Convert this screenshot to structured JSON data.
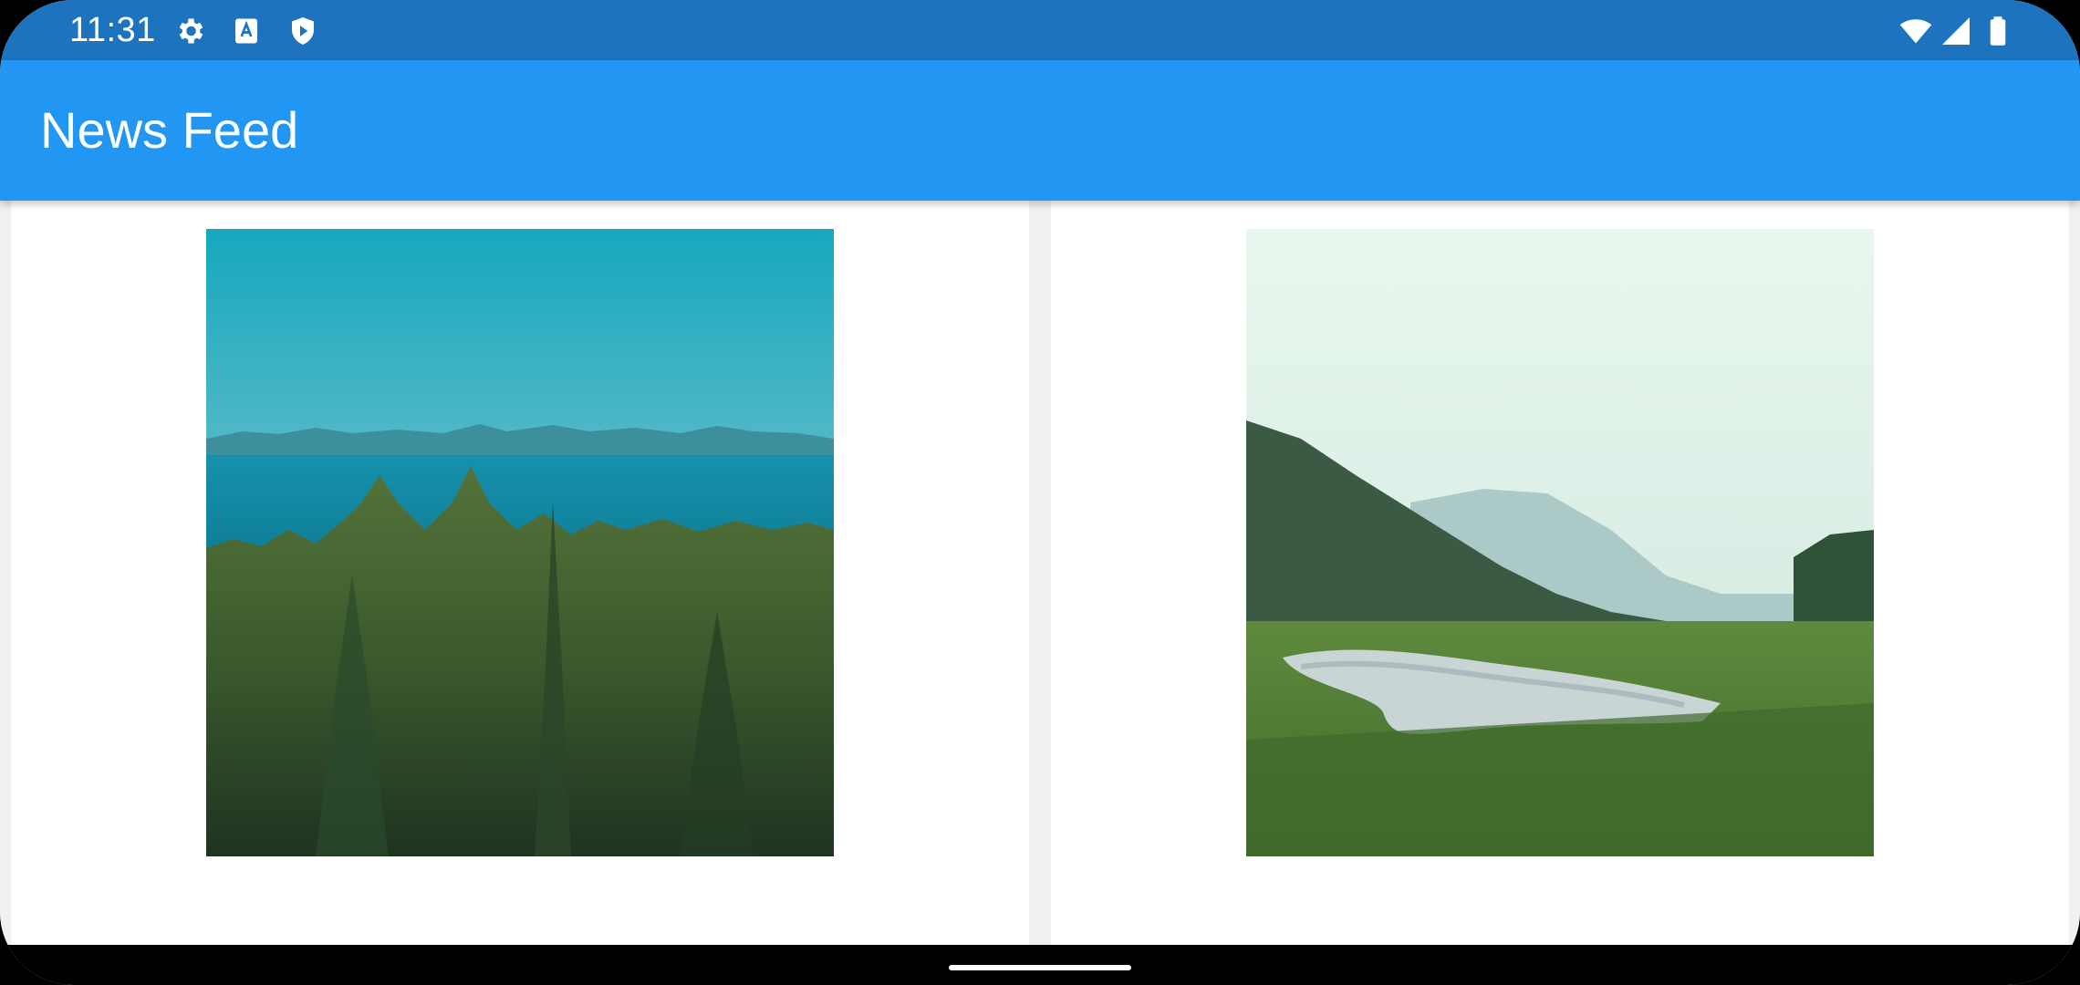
{
  "status_bar": {
    "time": "11:31",
    "left_icons": [
      "gear-icon",
      "text-a-icon",
      "play-shield-icon"
    ],
    "right_icons": [
      "wifi-icon",
      "cell-signal-icon",
      "battery-icon"
    ],
    "background": "#1e73be"
  },
  "app_bar": {
    "title": "News Feed",
    "background": "#2196f3"
  },
  "feed": {
    "items": [
      {
        "image": "forest-lake-mountains-photo"
      },
      {
        "image": "misty-river-valley-photo"
      }
    ]
  }
}
